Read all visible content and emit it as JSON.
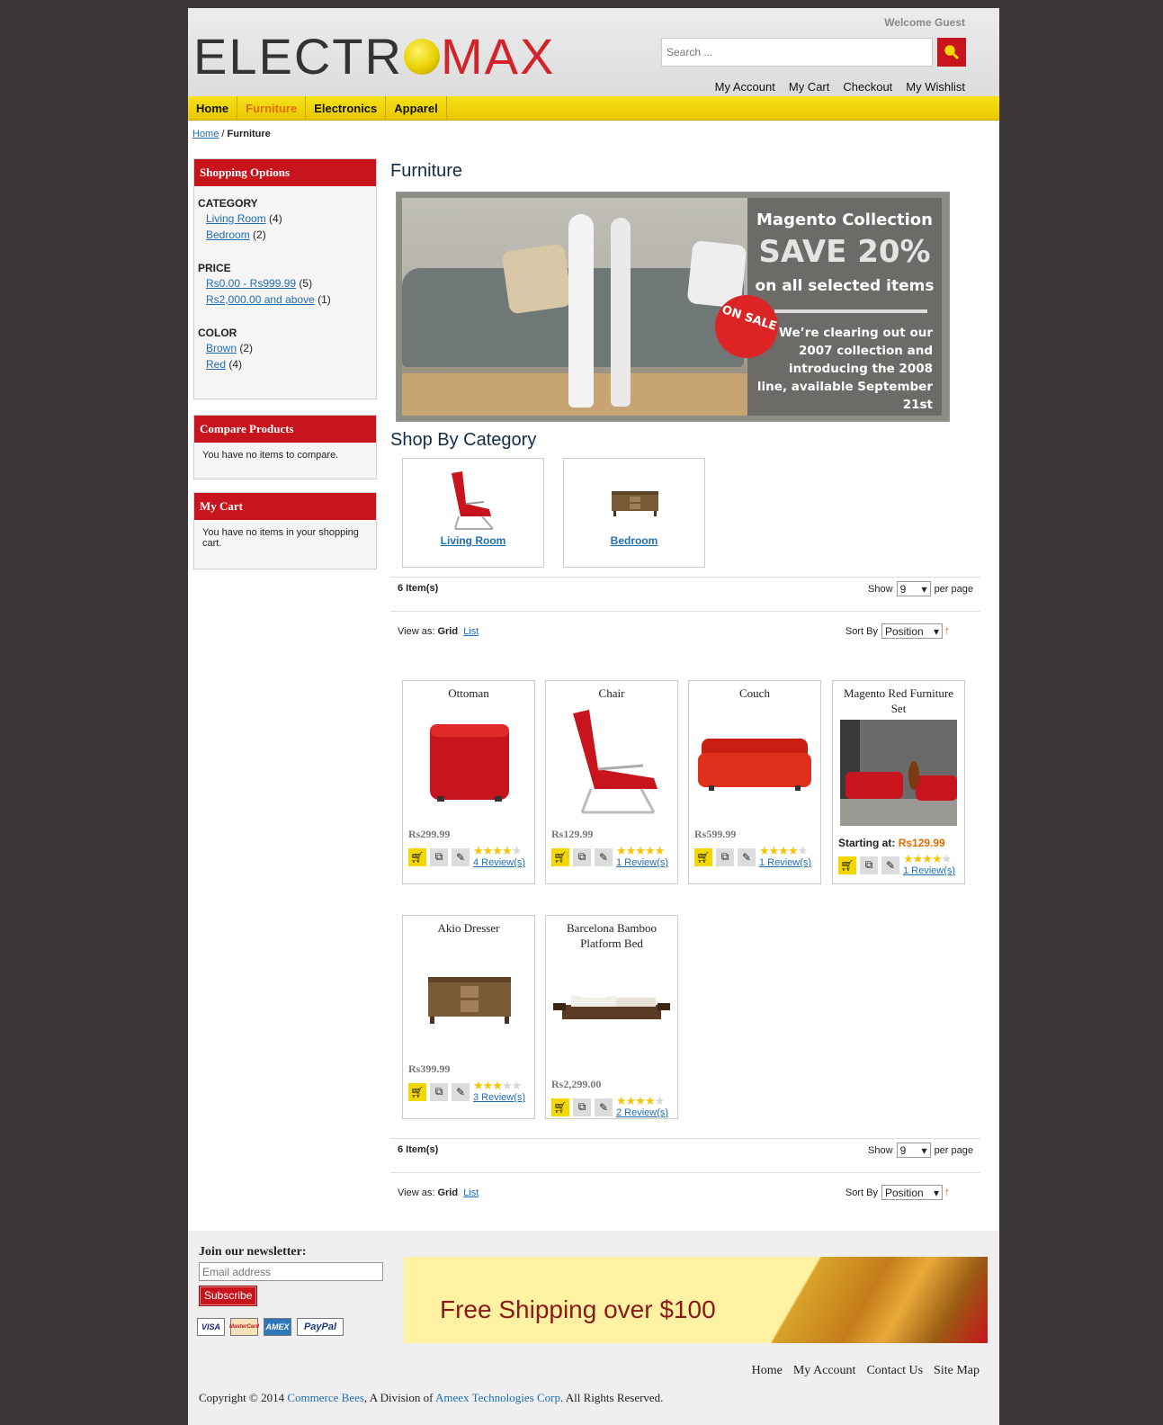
{
  "header": {
    "welcome": "Welcome Guest",
    "logo_part1": "ELECTR",
    "logo_part2": "MAX",
    "search_placeholder": "Search ...",
    "links": [
      "My Account",
      "My Cart",
      "Checkout",
      "My Wishlist"
    ]
  },
  "nav": {
    "items": [
      "Home",
      "Furniture",
      "Electronics",
      "Apparel"
    ],
    "active": "Furniture"
  },
  "breadcrumb": {
    "home": "Home",
    "separator": " / ",
    "current": "Furniture"
  },
  "sidebar": {
    "shopping_options": {
      "title": "Shopping Options",
      "groups": [
        {
          "name": "CATEGORY",
          "items": [
            {
              "label": "Living Room",
              "count": "(4)"
            },
            {
              "label": "Bedroom",
              "count": "(2)"
            }
          ]
        },
        {
          "name": "PRICE",
          "items": [
            {
              "label": "Rs0.00 - Rs999.99",
              "count": "(5)"
            },
            {
              "label": "Rs2,000.00 and above",
              "count": "(1)"
            }
          ]
        },
        {
          "name": "COLOR",
          "items": [
            {
              "label": "Brown",
              "count": "(2)"
            },
            {
              "label": "Red",
              "count": "(4)"
            }
          ]
        }
      ]
    },
    "compare": {
      "title": "Compare Products",
      "text": "You have no items to compare."
    },
    "cart": {
      "title": "My Cart",
      "text": "You have no items in your shopping cart."
    }
  },
  "main": {
    "title": "Furniture",
    "banner": {
      "line1": "Magento Collection",
      "line2": "SAVE 20%",
      "line3": "on all selected items",
      "line4": "We’re clearing out our 2007 collection and introducing the 2008 line, available September 21st",
      "sale": "ON SALE"
    },
    "shop_by_category": "Shop By Category",
    "categories": [
      "Living Room",
      "Bedroom"
    ],
    "toolbar": {
      "items": "6 Item(s)",
      "show": "Show",
      "per_page_value": "9",
      "per_page": "per page",
      "view_as": "View as:",
      "grid": "Grid",
      "list": "List",
      "sort_by": "Sort By",
      "sort_value": "Position"
    },
    "products": [
      {
        "name": "Ottoman",
        "price": "Rs299.99",
        "rating": 3.5,
        "reviews": "4 Review(s)",
        "color": "#c8141c"
      },
      {
        "name": "Chair",
        "price": "Rs129.99",
        "rating": 5,
        "reviews": "1 Review(s)",
        "color": "#c8141c"
      },
      {
        "name": "Couch",
        "price": "Rs599.99",
        "rating": 3.5,
        "reviews": "1 Review(s)",
        "color": "#d62a18"
      },
      {
        "name": "Magento Red Furniture Set",
        "price_prefix": "Starting at:",
        "price": "Rs129.99",
        "rating": 4,
        "reviews": "1 Review(s)",
        "color": "#c8141c"
      },
      {
        "name": "Akio Dresser",
        "price": "Rs399.99",
        "rating": 3,
        "reviews": "3 Review(s)",
        "color": "#7a5a36"
      },
      {
        "name": "Barcelona Bamboo Platform Bed",
        "price": "Rs2,299.00",
        "rating": 4,
        "reviews": "2 Review(s)",
        "color": "#5a3a22"
      }
    ]
  },
  "footer": {
    "newsletter_title": "Join our newsletter:",
    "email_placeholder": "Email address",
    "subscribe": "Subscribe",
    "cards": [
      "VISA",
      "MasterCard",
      "AMEX",
      "PayPal"
    ],
    "shipping": "Free Shipping over $100",
    "links": [
      "Home",
      "My Account",
      "Contact Us",
      "Site Map"
    ],
    "copyright_pre": "Copyright © 2014 ",
    "company": "Commerce Bees",
    "copyright_mid": ", A Division of ",
    "parent": "Ameex Technologies Corp",
    "copyright_post": ". All Rights Reserved."
  },
  "colors": {
    "brand_red": "#c8141c",
    "nav_yellow": "#f2d800",
    "accent_orange": "#e36b00",
    "link_blue": "#1f6eb5"
  }
}
